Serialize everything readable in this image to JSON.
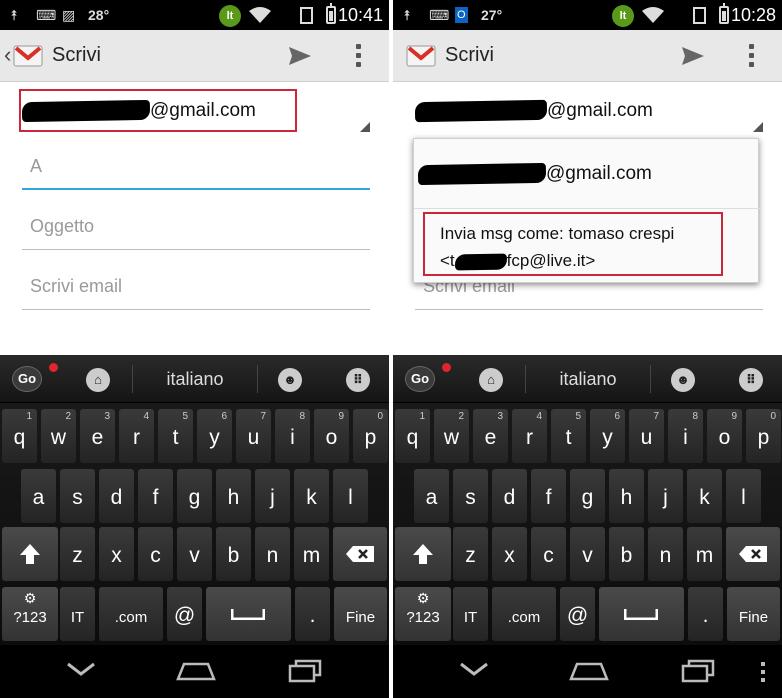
{
  "colors": {
    "highlight_box": "#c7283a",
    "accent_underline": "#33a5dd",
    "status_lt": "#5a9a1a"
  },
  "left": {
    "status": {
      "temperature": "28°",
      "network_badge": "lt",
      "time": "10:41"
    },
    "actionbar": {
      "title": "Scrivi"
    },
    "from_account": "@gmail.com",
    "to_placeholder": "A",
    "subject_placeholder": "Oggetto",
    "body_placeholder": "Scrivi email"
  },
  "right": {
    "status": {
      "temperature": "27°",
      "network_badge": "lt",
      "time": "10:28"
    },
    "actionbar": {
      "title": "Scrivi"
    },
    "from_account": "@gmail.com",
    "popup": {
      "option1": "@gmail.com",
      "option2_line1": "Invia msg come:  tomaso crespi",
      "option2_line2_prefix": "<t",
      "option2_line2_suffix": "fcp@live.it>"
    },
    "body_placeholder": "Scrivi email"
  },
  "keyboard": {
    "go_label": "Go",
    "language": "italiano",
    "row1": [
      {
        "letter": "q",
        "num": "1"
      },
      {
        "letter": "w",
        "num": "2"
      },
      {
        "letter": "e",
        "num": "3"
      },
      {
        "letter": "r",
        "num": "4"
      },
      {
        "letter": "t",
        "num": "5"
      },
      {
        "letter": "y",
        "num": "6"
      },
      {
        "letter": "u",
        "num": "7"
      },
      {
        "letter": "i",
        "num": "8"
      },
      {
        "letter": "o",
        "num": "9"
      },
      {
        "letter": "p",
        "num": "0"
      }
    ],
    "row2": [
      "a",
      "s",
      "d",
      "f",
      "g",
      "h",
      "j",
      "k",
      "l"
    ],
    "row3": [
      "z",
      "x",
      "c",
      "v",
      "b",
      "n",
      "m"
    ],
    "row4": {
      "symbols": "?123",
      "lang": "IT",
      "dotcom": ".com",
      "at": "@",
      "period": ".",
      "done": "Fine"
    }
  },
  "icons": [
    "gmail-logo-icon",
    "send-icon",
    "overflow-icon",
    "wifi-icon",
    "battery-icon",
    "shift-icon",
    "backspace-icon",
    "settings-icon",
    "spacebar-icon",
    "nav-back-icon",
    "nav-home-icon",
    "nav-recent-icon"
  ]
}
